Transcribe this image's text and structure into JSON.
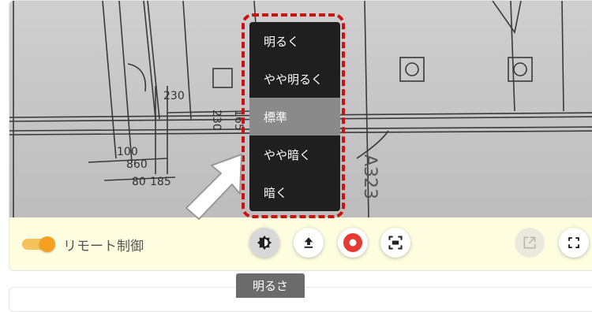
{
  "controls": {
    "remote_toggle_label": "リモート制御",
    "remote_toggle_on": true,
    "brightness_button_tooltip": "明るさ"
  },
  "brightness_menu": {
    "items": [
      {
        "label": "明るく"
      },
      {
        "label": "やや明るく"
      },
      {
        "label": "標準"
      },
      {
        "label": "やや暗く"
      },
      {
        "label": "暗く"
      }
    ],
    "selected": "標準"
  },
  "video_feed": {
    "annotations": [
      "A323",
      "230",
      "230",
      "100",
      "860",
      "165",
      "80",
      "185"
    ]
  },
  "colors": {
    "accent_orange": "#f5a020",
    "record_red": "#e53935",
    "highlight_red": "#cc1111",
    "menu_bg": "#1f1f1f",
    "control_bar_bg": "#fffde0"
  },
  "icons": {
    "brightness": "brightness-icon",
    "upload": "upload-icon",
    "record": "record-icon",
    "screenshot": "screenshot-icon",
    "external": "external-link-icon",
    "fullscreen": "fullscreen-icon"
  }
}
